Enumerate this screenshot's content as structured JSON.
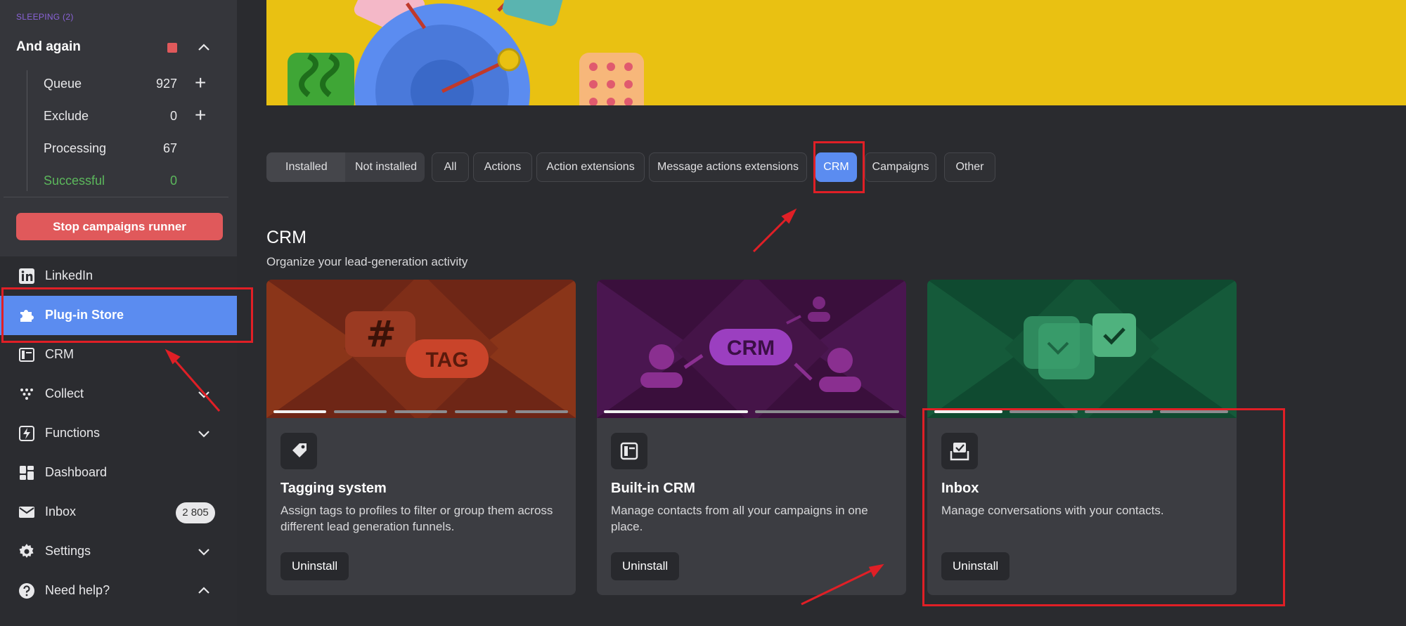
{
  "sidebar": {
    "section_label": "SLEEPING (2)",
    "group_title": "And again",
    "stats": [
      {
        "label": "Queue",
        "value": "927",
        "has_plus": true
      },
      {
        "label": "Exclude",
        "value": "0",
        "has_plus": true
      },
      {
        "label": "Processing",
        "value": "67",
        "has_plus": false
      },
      {
        "label": "Successful",
        "value": "0",
        "has_plus": false
      }
    ],
    "stop_button": "Stop campaigns runner",
    "nav": [
      {
        "label": "LinkedIn",
        "icon": "linkedin-icon"
      },
      {
        "label": "Plug-in Store",
        "icon": "puzzle-icon",
        "active": true
      },
      {
        "label": "CRM",
        "icon": "crm-icon"
      },
      {
        "label": "Collect",
        "icon": "collect-icon"
      },
      {
        "label": "Functions",
        "icon": "functions-icon"
      },
      {
        "label": "Dashboard",
        "icon": "dashboard-icon"
      },
      {
        "label": "Inbox",
        "icon": "inbox-icon",
        "badge": "2 805"
      },
      {
        "label": "Settings",
        "icon": "gear-icon"
      },
      {
        "label": "Need help?",
        "icon": "help-icon"
      }
    ]
  },
  "filters": {
    "segmented": [
      "Installed",
      "Not installed"
    ],
    "chips": [
      "All",
      "Actions",
      "Action extensions",
      "Message actions extensions",
      "CRM",
      "Campaigns",
      "Other"
    ],
    "active_chip": "CRM"
  },
  "section": {
    "title": "CRM",
    "subtitle": "Organize your lead-generation activity"
  },
  "cards": [
    {
      "title": "Tagging system",
      "description": "Assign tags to profiles to filter or group them across different lead generation funnels.",
      "button": "Uninstall",
      "art_text": "TAG",
      "art_symbol": "#",
      "icon": "tag-icon"
    },
    {
      "title": "Built-in CRM",
      "description": "Manage contacts from all your campaigns in one place.",
      "button": "Uninstall",
      "art_text": "CRM",
      "icon": "crm-icon"
    },
    {
      "title": "Inbox",
      "description": "Manage conversations with your contacts.",
      "button": "Uninstall",
      "icon": "inbox-icon"
    }
  ],
  "colors": {
    "accent": "#5b8cf0",
    "danger": "#e0595b",
    "success": "#5cb85c",
    "annotation": "#e01f26",
    "banner": "#e9c112"
  }
}
